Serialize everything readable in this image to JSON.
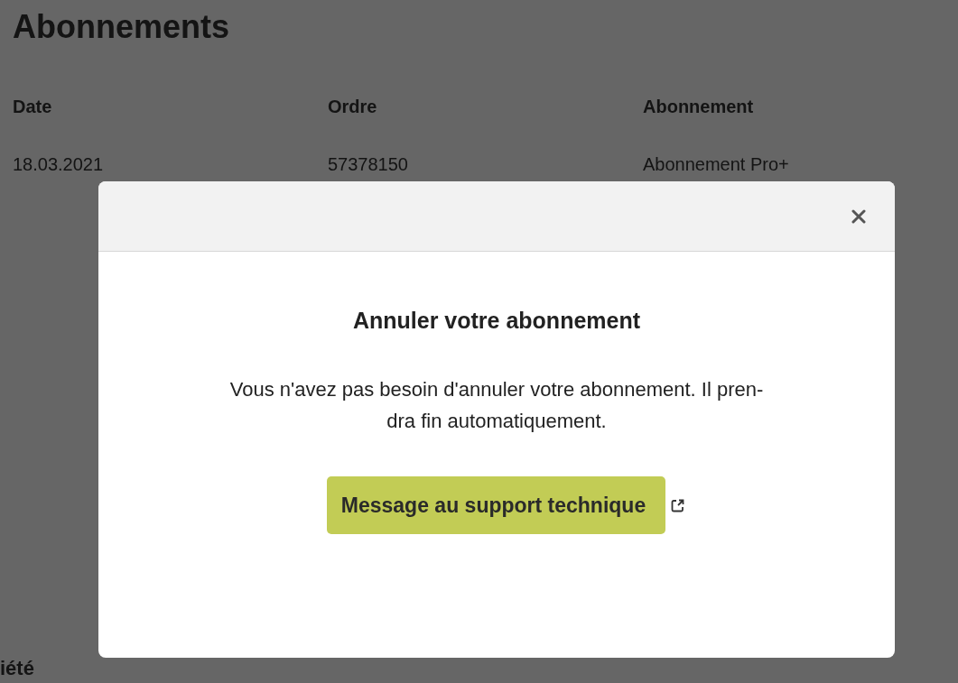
{
  "page": {
    "title": "Abonnements",
    "table": {
      "columns": [
        "Date",
        "Ordre",
        "Abonnement"
      ],
      "rows": [
        [
          "18.03.2021",
          "57378150",
          "Abonnement Pro+"
        ]
      ]
    },
    "section_heading": "iété"
  },
  "modal": {
    "title": "Annuler votre abonnement",
    "message": "Vous n'avez pas besoin d'annuler votre abonnement. Il pren-dra fin automatiquement.",
    "button": "Message au support technique"
  }
}
